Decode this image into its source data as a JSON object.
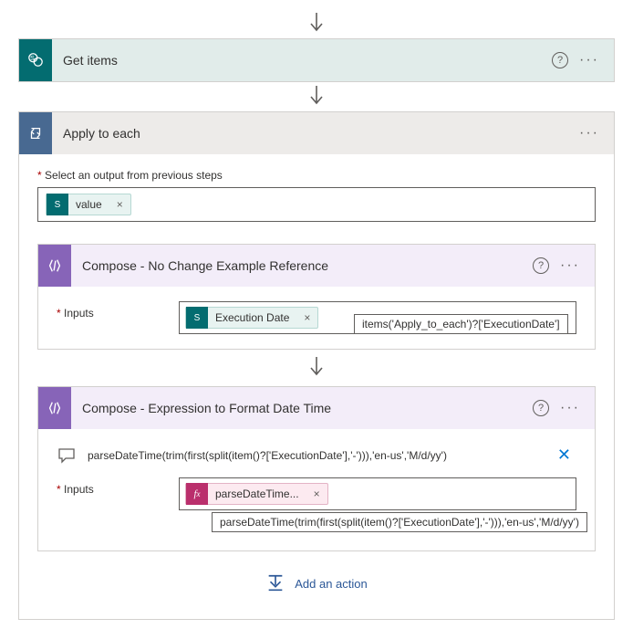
{
  "getItems": {
    "title": "Get items"
  },
  "applyToEach": {
    "title": "Apply to each",
    "selectLabel": "Select an output from previous steps",
    "selectedTokenText": "value"
  },
  "compose1": {
    "title": "Compose - No Change Example Reference",
    "inputsLabel": "Inputs",
    "tokenText": "Execution Date",
    "tooltip": "items('Apply_to_each')?['ExecutionDate']"
  },
  "compose2": {
    "title": "Compose - Expression to Format Date Time",
    "peekText": "parseDateTime(trim(first(split(item()?['ExecutionDate'],'-'))),'en-us','M/d/yy')",
    "inputsLabel": "Inputs",
    "tokenText": "parseDateTime...",
    "tooltip": "parseDateTime(trim(first(split(item()?['ExecutionDate'],'-'))),'en-us','M/d/yy')"
  },
  "addAction": {
    "label": "Add an action"
  }
}
